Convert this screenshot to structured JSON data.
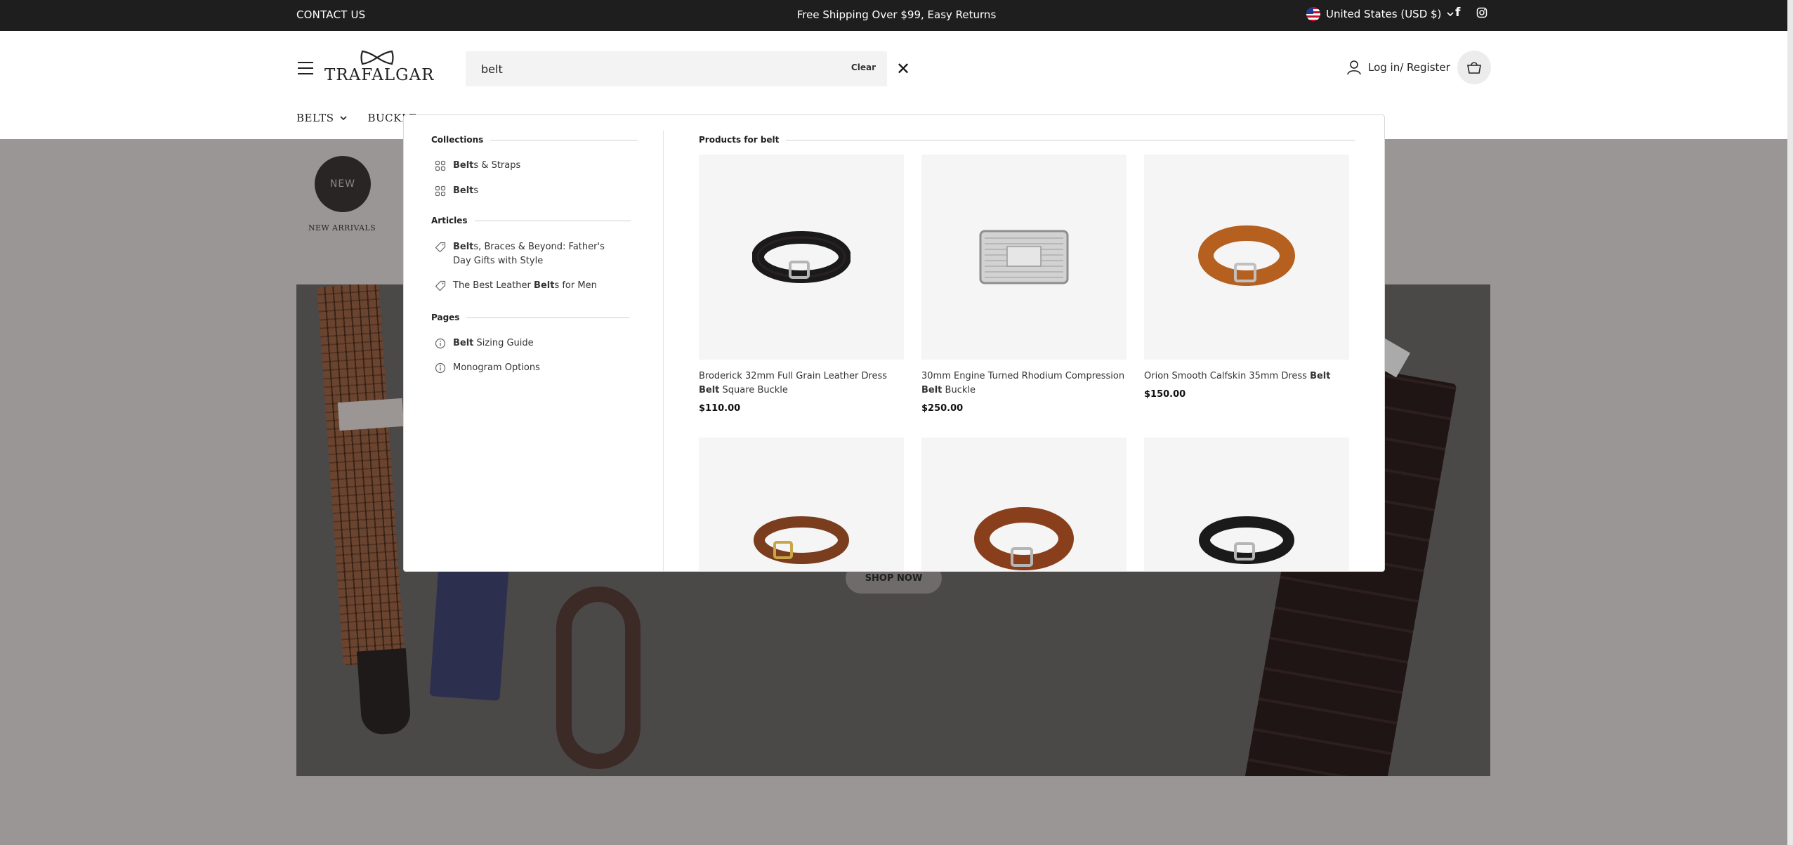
{
  "topbar": {
    "contact": "CONTACT US",
    "promo": "Free Shipping Over $99, Easy Returns",
    "locale": "United States (USD $)"
  },
  "header": {
    "logo_text": "TRAFALGAR",
    "search": {
      "value": "belt",
      "clear_label": "Clear"
    },
    "login_label": "Log in/ Register"
  },
  "nav": {
    "items": [
      "BELTS",
      "BUCKLE"
    ]
  },
  "page": {
    "new_badge": "NEW",
    "new_label": "NEW ARRIVALS",
    "shop_now": "SHOP NOW"
  },
  "dropdown": {
    "collections_title": "Collections",
    "collections": [
      {
        "bold": "Belt",
        "rest": "s & Straps"
      },
      {
        "bold": "Belt",
        "rest": "s"
      }
    ],
    "articles_title": "Articles",
    "articles": [
      {
        "pre": "",
        "bold": "Belt",
        "rest": "s, Braces & Beyond: Father's Day Gifts with Style"
      },
      {
        "pre": "The Best Leather ",
        "bold": "Belt",
        "rest": "s for Men"
      }
    ],
    "pages_title": "Pages",
    "pages": [
      {
        "pre": "",
        "bold": "Belt",
        "rest": " Sizing Guide"
      },
      {
        "pre": "Monogram Options",
        "bold": "",
        "rest": ""
      }
    ],
    "products_title": "Products for belt",
    "products": [
      {
        "pre": "Broderick 32mm Full Grain Leather Dress ",
        "bold": "Belt",
        "rest": " Square Buckle",
        "price": "$110.00"
      },
      {
        "pre": "30mm Engine Turned Rhodium Compression ",
        "bold": "Belt",
        "rest": " Buckle",
        "price": "$250.00"
      },
      {
        "pre": "Orion Smooth Calfskin 35mm Dress ",
        "bold": "Belt",
        "rest": "",
        "price": "$150.00"
      }
    ]
  },
  "colors": {
    "topbar_bg": "#1e1e1e",
    "overlay": "#9a9696",
    "badge_dark": "#2a2525",
    "belt_black": "#1a1a1a",
    "belt_tan": "#b5601f",
    "belt_brown": "#7a3d1e"
  }
}
